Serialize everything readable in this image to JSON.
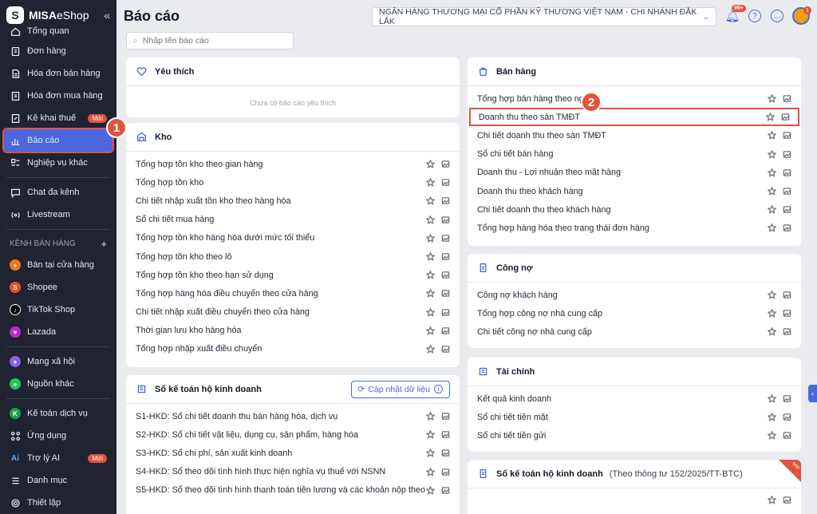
{
  "brand": {
    "name_bold": "MISA",
    "name_light": "eShop"
  },
  "sidebar": {
    "items": [
      {
        "label": "Tổng quan"
      },
      {
        "label": "Đơn hàng"
      },
      {
        "label": "Hóa đơn bán hàng"
      },
      {
        "label": "Hóa đơn mua hàng"
      },
      {
        "label": "Kê khai thuế",
        "badge": "Mới"
      },
      {
        "label": "Báo cáo"
      },
      {
        "label": "Nghiệp vụ khác"
      },
      {
        "label": "Chat đa kênh"
      },
      {
        "label": "Livestream"
      }
    ],
    "channels_label": "KÊNH BÁN HÀNG",
    "channels": [
      {
        "label": "Bán tại cửa hàng"
      },
      {
        "label": "Shopee"
      },
      {
        "label": "TikTok Shop"
      },
      {
        "label": "Lazada"
      }
    ],
    "others": [
      {
        "label": "Mạng xã hội"
      },
      {
        "label": "Nguồn khác"
      }
    ],
    "bottom": [
      {
        "label": "Kế toán dịch vụ"
      },
      {
        "label": "Ứng dụng"
      },
      {
        "label": "Trợ lý AI",
        "badge": "Mới"
      },
      {
        "label": "Danh mục"
      },
      {
        "label": "Thiết lập"
      }
    ]
  },
  "steps": {
    "one": "1",
    "two": "2"
  },
  "header": {
    "title": "Báo cáo",
    "branch": "NGÂN HÀNG THƯƠNG MẠI CỔ PHẦN KỸ THƯƠNG VIỆT NAM - CHI NHÁNH ĐẮK LẮK",
    "bell_badge": "99+",
    "avatar_badge": "1"
  },
  "search": {
    "placeholder": "Nhập tên báo cáo"
  },
  "favorites": {
    "title": "Yêu thích",
    "empty": "Chưa có báo cáo yêu thích"
  },
  "kho": {
    "title": "Kho",
    "rows": [
      "Tổng hợp tồn kho theo gian hàng",
      "Tổng hợp tồn kho",
      "Chi tiết nhập xuất tồn kho theo hàng hóa",
      "Sổ chi tiết mua hàng",
      "Tổng hợp tồn kho hàng hóa dưới mức tối thiểu",
      "Tổng hợp tồn kho theo lô",
      "Tổng hợp tồn kho theo hạn sử dụng",
      "Tổng hợp hàng hóa điều chuyển theo cửa hàng",
      "Chi tiết nhập xuất điều chuyển theo cửa hàng",
      "Thời gian lưu kho hàng hóa",
      "Tổng hợp nhập xuất điều chuyển"
    ]
  },
  "ledger": {
    "title": "Sổ kế toán hộ kinh doanh",
    "update_label": "Cập nhật dữ liệu",
    "rows": [
      "S1-HKD: Sổ chi tiết doanh thu bán hàng hóa, dịch vụ",
      "S2-HKD: Sổ chi tiết vật liệu, dụng cụ, sản phẩm, hàng hóa",
      "S3-HKD: Sổ chi phí, sản xuất kinh doanh",
      "S4-HKD: Sổ theo dõi tình hình thực hiện nghĩa vụ thuế với NSNN",
      "S5-HKD: Sổ theo dõi tình hình thanh toán tiền lương và các khoản nộp theo"
    ]
  },
  "sales": {
    "title": "Bán hàng",
    "rows": [
      "Tổng hợp bán hàng theo ngày",
      "Doanh thu theo sàn TMĐT",
      "Chi tiết doanh thu theo sàn TMĐT",
      "Sổ chi tiết bán hàng",
      "Doanh thu - Lợi nhuận theo mặt hàng",
      "Doanh thu theo khách hàng",
      "Chi tiết doanh thu theo khách hàng",
      "Tổng hợp hàng hóa theo trạng thái đơn hàng"
    ]
  },
  "debt": {
    "title": "Công nợ",
    "rows": [
      "Công nợ khách hàng",
      "Tổng hợp công nợ nhà cung cấp",
      "Chi tiết công nợ nhà cung cấp"
    ]
  },
  "finance": {
    "title": "Tài chính",
    "rows": [
      "Kết quả kinh doanh",
      "Sổ chi tiết tiền mặt",
      "Sổ chi tiết tiền gửi"
    ]
  },
  "ledger2": {
    "title": "Sổ kế toán hộ kinh doanh",
    "subtitle": "(Theo thông tư 152/2025/TT-BTC)",
    "ribbon": "Mới"
  },
  "colors": {
    "accent": "#4a67e0",
    "highlight": "#e0533d",
    "sidebar": "#1f2430"
  }
}
